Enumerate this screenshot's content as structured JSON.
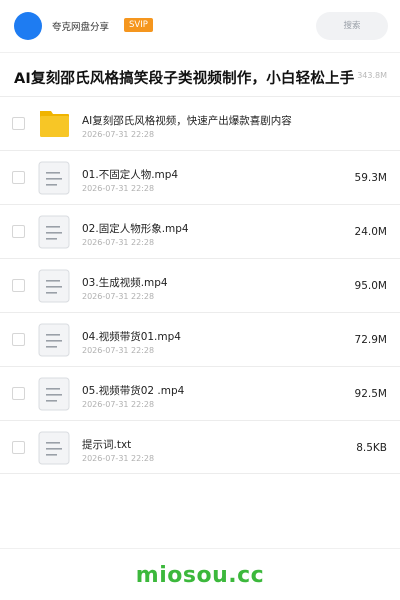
{
  "header": {
    "user_name": "夸克网盘分享",
    "badge": "SVIP",
    "search_placeholder": "搜索"
  },
  "share": {
    "title": "AI复刻邵氏风格搞笑段子类视频制作，小白轻松上手",
    "total_size": "343.8M"
  },
  "files": [
    {
      "name": "AI复刻邵氏风格视频，快速产出爆款喜剧内容",
      "date": "2026-07-31 22:28",
      "size": "",
      "type": "folder"
    },
    {
      "name": "01.不固定人物.mp4",
      "date": "2026-07-31 22:28",
      "size": "59.3M",
      "type": "file"
    },
    {
      "name": "02.固定人物形象.mp4",
      "date": "2026-07-31 22:28",
      "size": "24.0M",
      "type": "file"
    },
    {
      "name": "03.生成视频.mp4",
      "date": "2026-07-31 22:28",
      "size": "95.0M",
      "type": "file"
    },
    {
      "name": "04.视频带货01.mp4",
      "date": "2026-07-31 22:28",
      "size": "72.9M",
      "type": "file"
    },
    {
      "name": "05.视频带货02  .mp4",
      "date": "2026-07-31 22:28",
      "size": "92.5M",
      "type": "file"
    },
    {
      "name": "提示词.txt",
      "date": "2026-07-31 22:28",
      "size": "8.5KB",
      "type": "file"
    }
  ],
  "icons": {
    "folder": "folder-icon",
    "file": "document-icon"
  },
  "colors": {
    "accent": "#1e7cf2",
    "svip": "#f5961e",
    "folder": "#f7c626",
    "watermark": "#3cb83c"
  },
  "watermark": "miosou.cc"
}
